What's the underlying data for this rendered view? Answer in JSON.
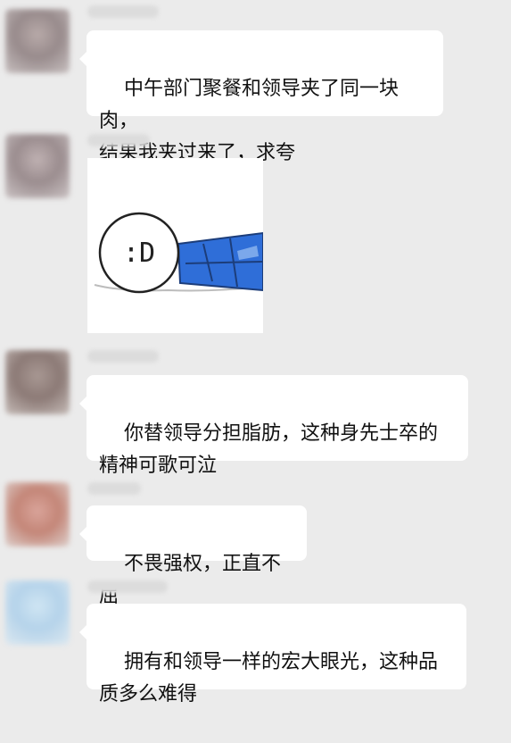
{
  "chat": {
    "messages": [
      {
        "type": "text",
        "text": "中午部门聚餐和领导夹了同一块肉，\n结果我夹过来了，求夸"
      },
      {
        "type": "sticker",
        "sticker_text": ":D",
        "icon": "face-lying-down-sticker-icon"
      },
      {
        "type": "text",
        "text": "你替领导分担脂肪，这种身先士卒的\n精神可歌可泣"
      },
      {
        "type": "text",
        "text": "不畏强权，正直不屈"
      },
      {
        "type": "text",
        "text": "拥有和领导一样的宏大眼光，这种品\n质多么难得"
      }
    ]
  },
  "colors": {
    "background": "#ebebeb",
    "bubble": "#ffffff",
    "text": "#111111",
    "sticker_shirt": "#2f6ed8"
  }
}
